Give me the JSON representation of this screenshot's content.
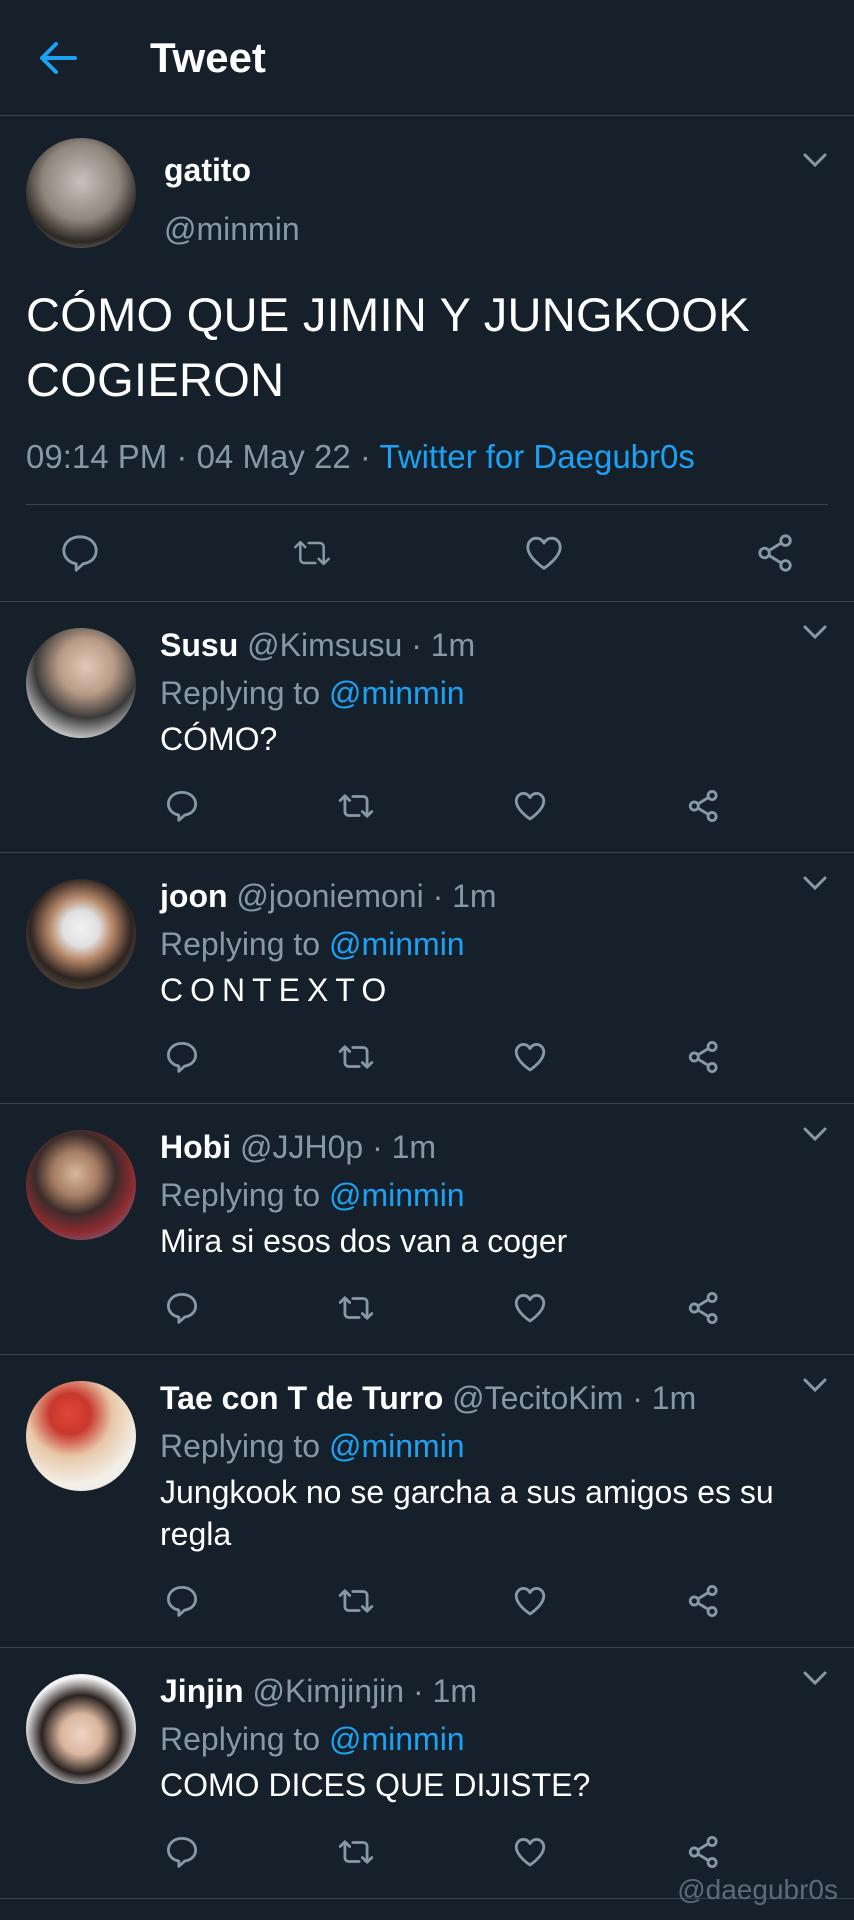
{
  "header": {
    "title": "Tweet",
    "back_icon": "arrow-left-icon"
  },
  "main_tweet": {
    "name": "gatito",
    "handle": "@minmin",
    "text": "CÓMO QUE JIMIN Y JUNGKOOK COGIERON",
    "time": "09:14 PM",
    "date": "04 May 22",
    "source": "Twitter for Daegubr0s"
  },
  "replies": [
    {
      "name": "Susu",
      "handle": "@Kimsusu",
      "time": "1m",
      "replying_label": "Replying to",
      "replying_to": "@minmin",
      "text": "CÓMO?"
    },
    {
      "name": "joon",
      "handle": "@jooniemoni",
      "time": "1m",
      "replying_label": "Replying to",
      "replying_to": "@minmin",
      "text": "CONTEXTO"
    },
    {
      "name": "Hobi",
      "handle": "@JJH0p",
      "time": "1m",
      "replying_label": "Replying to",
      "replying_to": "@minmin",
      "text": "Mira si esos dos van a coger"
    },
    {
      "name": "Tae con T de Turro",
      "handle": "@TecitoKim",
      "time": "1m",
      "replying_label": "Replying to",
      "replying_to": "@minmin",
      "text": "Jungkook no se garcha a sus amigos es su regla"
    },
    {
      "name": "Jinjin",
      "handle": "@Kimjinjin",
      "time": "1m",
      "replying_label": "Replying to",
      "replying_to": "@minmin",
      "text": "COMO DICES QUE DIJISTE?"
    }
  ],
  "watermark": "@daegubr0s",
  "colors": {
    "background": "#15202b",
    "accent": "#1da1f2",
    "secondary_text": "#8899a6",
    "divider": "#38444d"
  }
}
